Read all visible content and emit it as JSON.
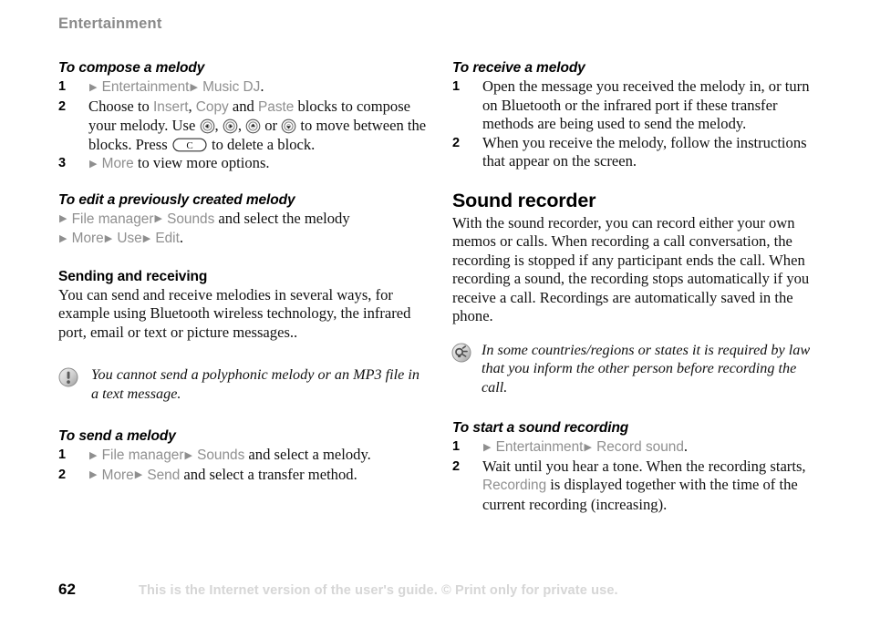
{
  "header": {
    "title": "Entertainment"
  },
  "footer": {
    "page_number": "62",
    "notice": "This is the Internet version of the user's guide. © Print only for private use."
  },
  "colors": {
    "ui_term_gray": "#8f8f8f",
    "header_gray": "#8a8a8a",
    "footer_gray": "#d6d6d6",
    "body_text": "#111111"
  },
  "left_column": {
    "proc_compose": {
      "title": "To compose a melody",
      "steps": [
        {
          "num": "1",
          "parts": [
            {
              "type": "arrow"
            },
            {
              "type": "ui",
              "text": "Entertainment"
            },
            {
              "type": "arrow"
            },
            {
              "type": "ui",
              "text": "Music DJ"
            },
            {
              "type": "text",
              "text": "."
            }
          ]
        },
        {
          "num": "2",
          "parts": [
            {
              "type": "text",
              "text": "Choose to "
            },
            {
              "type": "ui",
              "text": "Insert"
            },
            {
              "type": "text",
              "text": ", "
            },
            {
              "type": "ui",
              "text": "Copy"
            },
            {
              "type": "text",
              "text": " and "
            },
            {
              "type": "ui",
              "text": "Paste"
            },
            {
              "type": "text",
              "text": " blocks to compose your melody. Use "
            },
            {
              "type": "icon",
              "icon": "nav-key-left-icon"
            },
            {
              "type": "text",
              "text": ", "
            },
            {
              "type": "icon",
              "icon": "nav-key-right-icon"
            },
            {
              "type": "text",
              "text": ", "
            },
            {
              "type": "icon",
              "icon": "nav-key-up-icon"
            },
            {
              "type": "text",
              "text": " or "
            },
            {
              "type": "icon",
              "icon": "nav-key-down-icon"
            },
            {
              "type": "text",
              "text": " to move between the blocks. Press "
            },
            {
              "type": "icon",
              "icon": "clear-key-icon",
              "label": "C"
            },
            {
              "type": "text",
              "text": " to delete a block."
            }
          ]
        },
        {
          "num": "3",
          "parts": [
            {
              "type": "arrow"
            },
            {
              "type": "ui",
              "text": "More"
            },
            {
              "type": "text",
              "text": " to view more options."
            }
          ]
        }
      ]
    },
    "proc_edit": {
      "title": "To edit a previously created melody",
      "lines": [
        {
          "parts": [
            {
              "type": "arrow"
            },
            {
              "type": "ui",
              "text": "File manager"
            },
            {
              "type": "arrow"
            },
            {
              "type": "ui",
              "text": "Sounds"
            },
            {
              "type": "text",
              "text": " and select the melody"
            }
          ]
        },
        {
          "parts": [
            {
              "type": "arrow"
            },
            {
              "type": "ui",
              "text": "More"
            },
            {
              "type": "arrow"
            },
            {
              "type": "ui",
              "text": "Use"
            },
            {
              "type": "arrow"
            },
            {
              "type": "ui",
              "text": "Edit"
            },
            {
              "type": "text",
              "text": "."
            }
          ]
        }
      ]
    },
    "sub_sending": {
      "title": "Sending and receiving",
      "body": "You can send and receive melodies in several ways, for example using Bluetooth wireless technology, the infrared port, email or text or picture messages.."
    },
    "note": {
      "icon": "exclamation-note-icon",
      "text": "You cannot send a polyphonic melody or an MP3 file in a text message."
    },
    "proc_send": {
      "title": "To send a melody",
      "steps": [
        {
          "num": "1",
          "parts": [
            {
              "type": "arrow"
            },
            {
              "type": "ui",
              "text": "File manager"
            },
            {
              "type": "arrow"
            },
            {
              "type": "ui",
              "text": "Sounds"
            },
            {
              "type": "text",
              "text": " and select a melody."
            }
          ]
        },
        {
          "num": "2",
          "parts": [
            {
              "type": "arrow"
            },
            {
              "type": "ui",
              "text": "More"
            },
            {
              "type": "arrow"
            },
            {
              "type": "ui",
              "text": "Send"
            },
            {
              "type": "text",
              "text": " and select a transfer method."
            }
          ]
        }
      ]
    }
  },
  "right_column": {
    "proc_receive": {
      "title": "To receive a melody",
      "steps": [
        {
          "num": "1",
          "parts": [
            {
              "type": "text",
              "text": "Open the message you received the melody in, or turn on Bluetooth or the infrared port if these transfer methods are being used to send the melody."
            }
          ]
        },
        {
          "num": "2",
          "parts": [
            {
              "type": "text",
              "text": "When you receive the melody, follow the instructions that appear on the screen."
            }
          ]
        }
      ]
    },
    "section_sound_recorder": {
      "title": "Sound recorder",
      "body": "With the sound recorder, you can record either your own memos or calls. When recording a call conversation, the recording is stopped if any participant ends the call. When recording a sound, the recording stops automatically if you receive a call. Recordings are automatically saved in the phone."
    },
    "tip": {
      "icon": "tip-bulb-icon",
      "text": "In some countries/regions or states it is required by law that you inform the other person before recording the call."
    },
    "proc_start_recording": {
      "title": "To start a sound recording",
      "steps": [
        {
          "num": "1",
          "parts": [
            {
              "type": "arrow"
            },
            {
              "type": "ui",
              "text": "Entertainment"
            },
            {
              "type": "arrow"
            },
            {
              "type": "ui",
              "text": "Record sound"
            },
            {
              "type": "text",
              "text": "."
            }
          ]
        },
        {
          "num": "2",
          "parts": [
            {
              "type": "text",
              "text": "Wait until you hear a tone. When the recording starts, "
            },
            {
              "type": "ui",
              "text": "Recording"
            },
            {
              "type": "text",
              "text": " is displayed together with the time of the current recording (increasing)."
            }
          ]
        }
      ]
    }
  }
}
